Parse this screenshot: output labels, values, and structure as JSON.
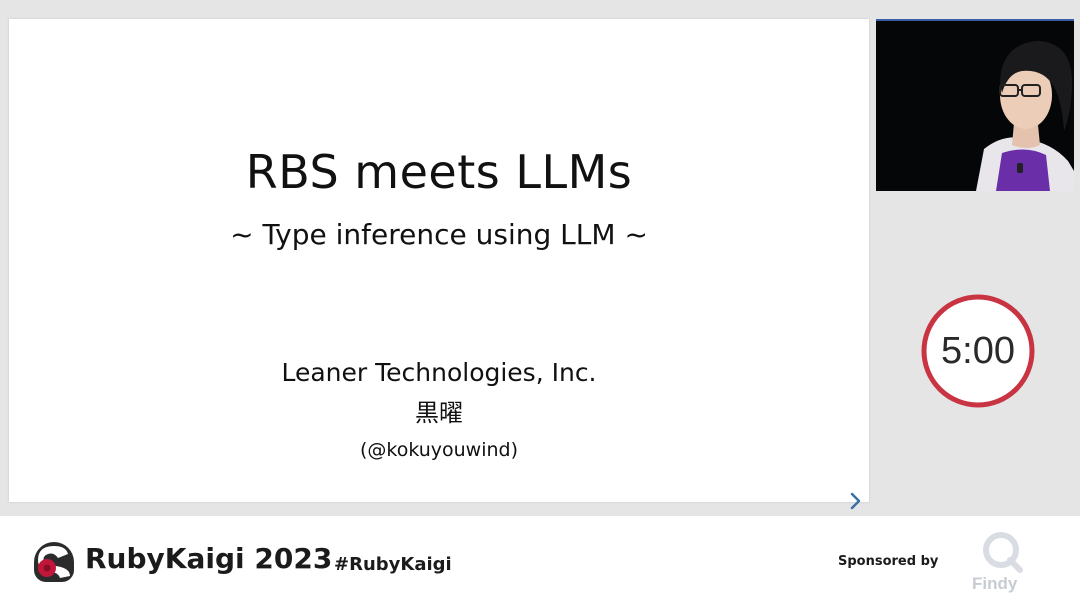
{
  "slide": {
    "title": "RBS meets LLMs",
    "subtitle": "~ Type inference using LLM ~",
    "company": "Leaner Technologies, Inc.",
    "name": "黒曜",
    "handle": "(@kokuyouwind)",
    "next_icon": "chevron-right-icon"
  },
  "timer": {
    "display": "5:00",
    "ring_color": "#c93442"
  },
  "footer": {
    "brand": "RubyKaigi 2023",
    "hashtag": "#RubyKaigi",
    "sponsored_label": "Sponsored by",
    "sponsor_name": "Findy"
  },
  "colors": {
    "brand_red": "#c0163a",
    "brand_dark": "#2b2b2b",
    "accent_blue": "#3a5fa8"
  }
}
